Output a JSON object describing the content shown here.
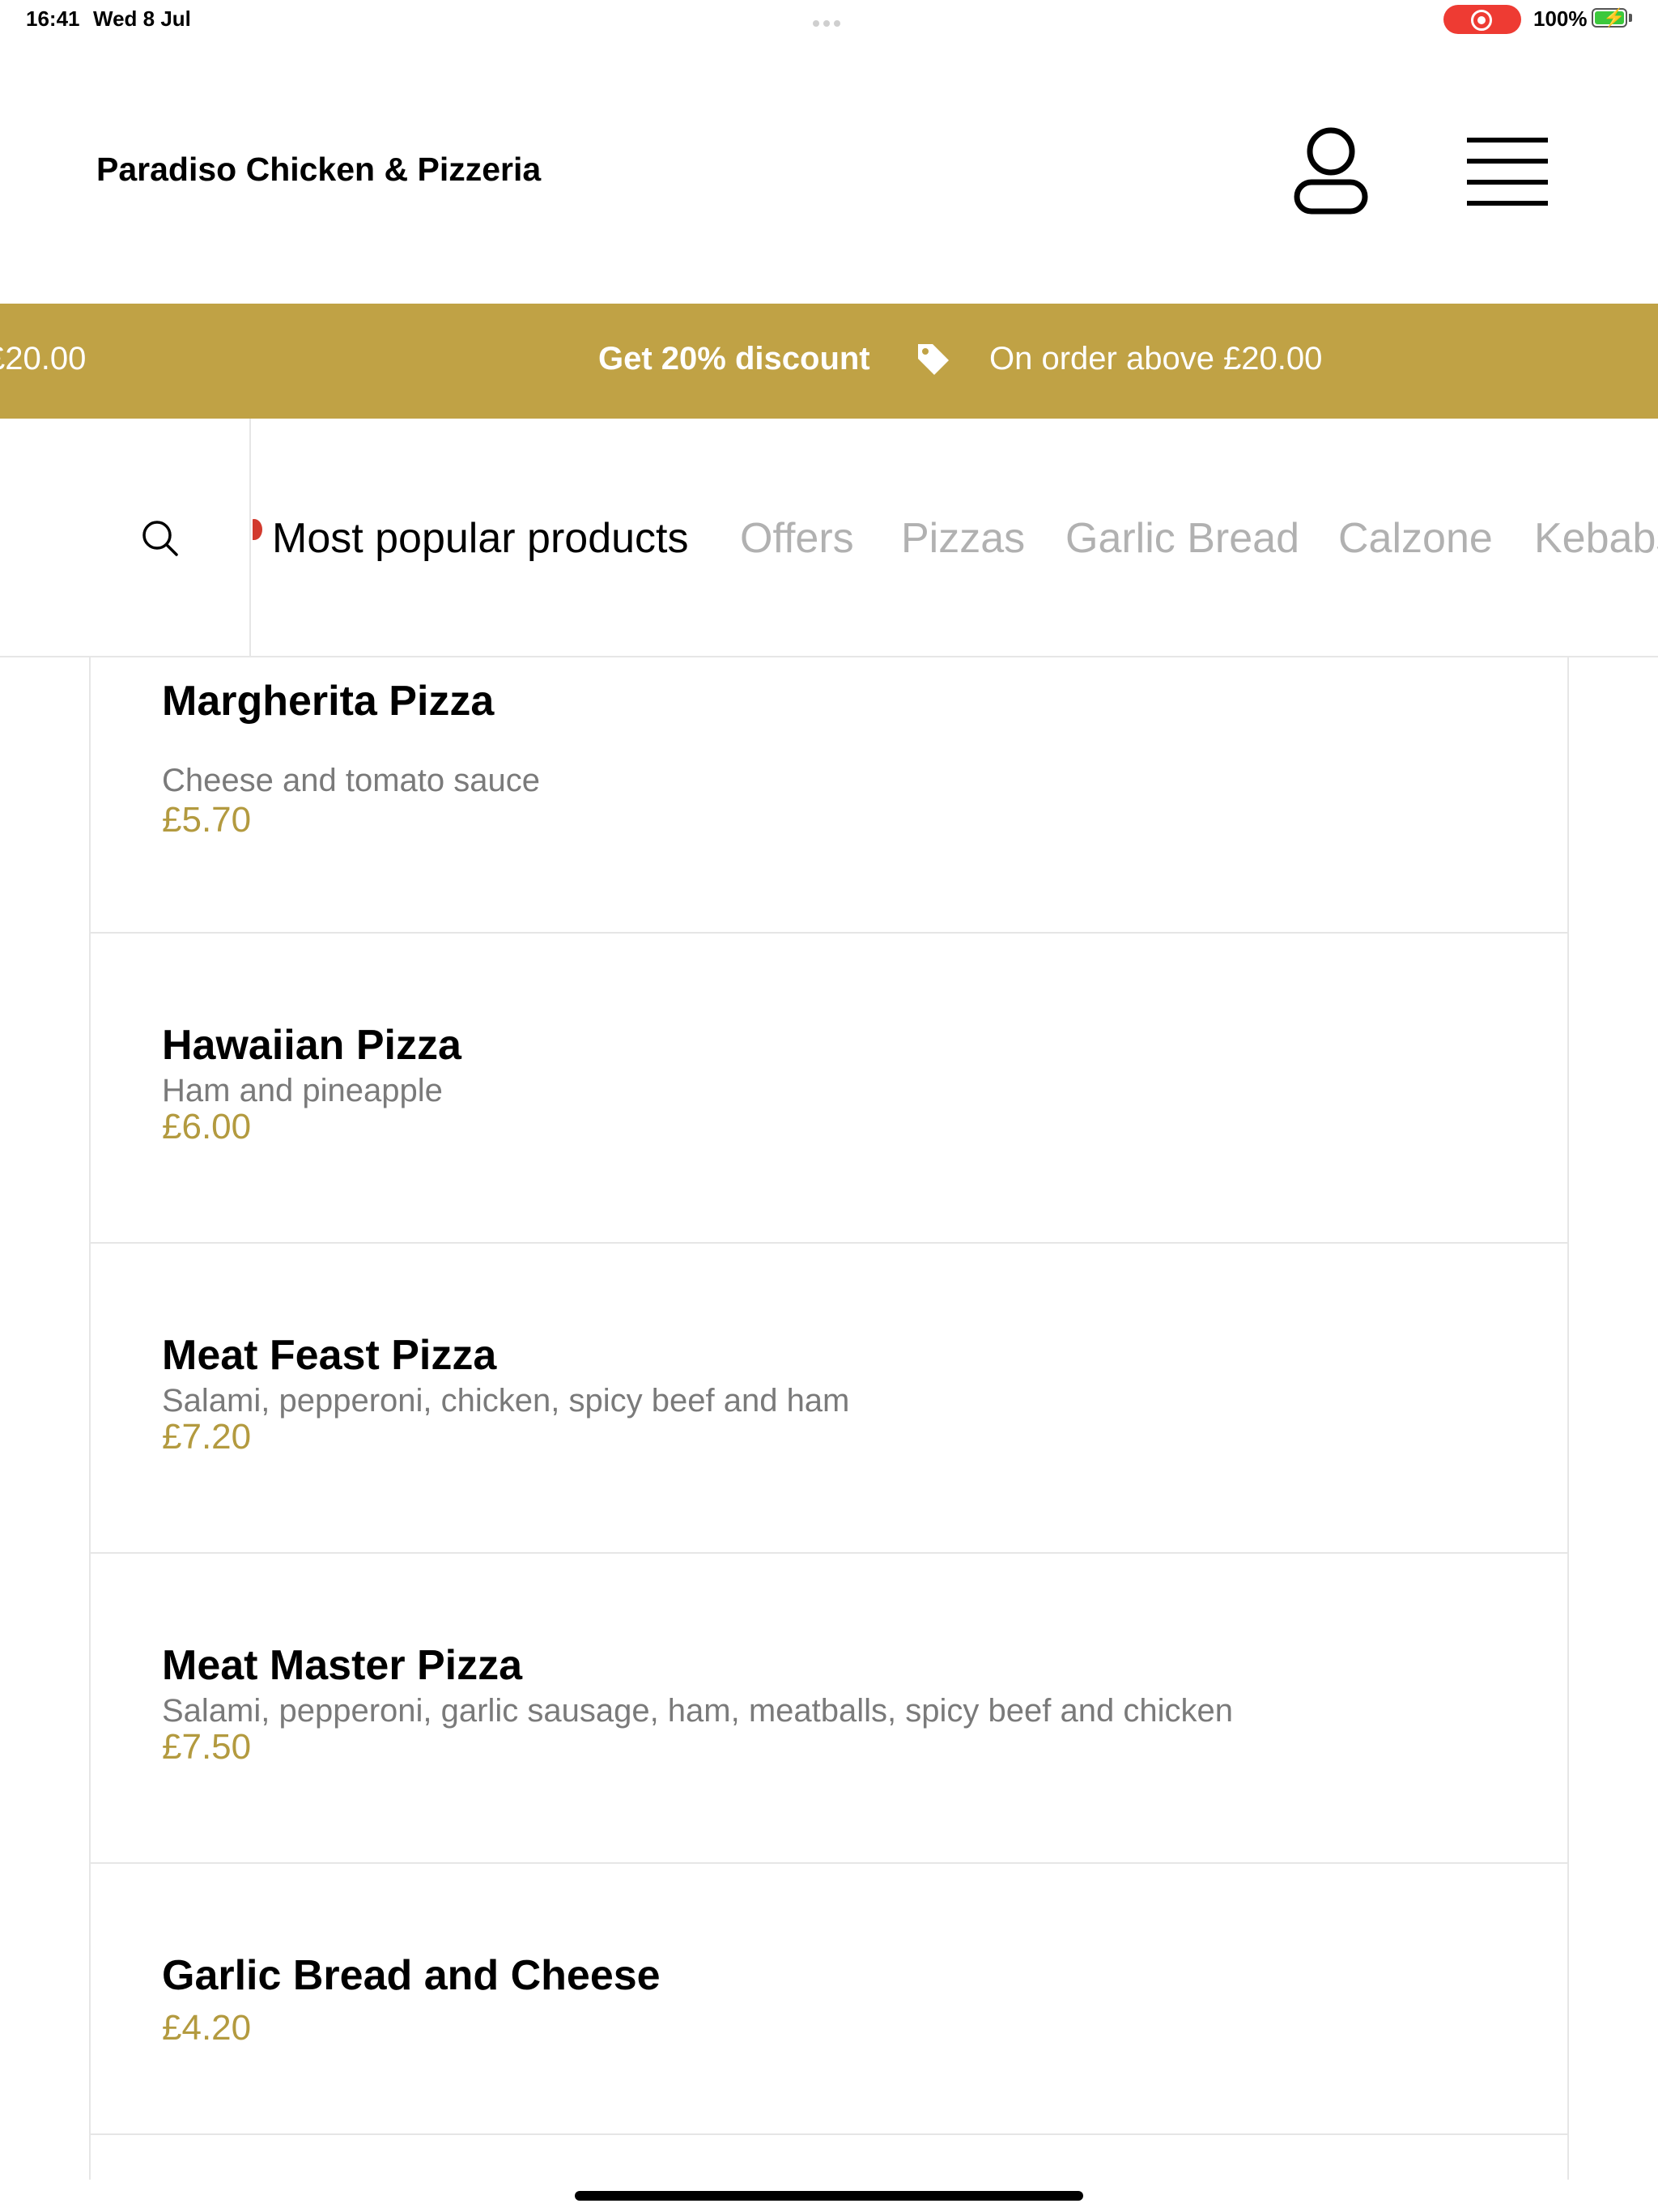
{
  "status_bar": {
    "time": "16:41",
    "date": "Wed 8 Jul",
    "battery_percent": "100%",
    "battery_level": 1.0,
    "recording": true,
    "icons": [
      "screen-recording-icon",
      "battery-charging-icon"
    ]
  },
  "header": {
    "restaurant_name": "Paradiso Chicken & Pizzeria",
    "icons": [
      "user-icon",
      "menu-icon"
    ]
  },
  "promo_banner": {
    "partial_text": "£20.00",
    "title": "Get 20% discount",
    "icon": "tag-icon",
    "text": "On order above £20.00",
    "background_color": "#c0a245"
  },
  "categories": {
    "search_icon": "search-icon",
    "items": [
      "Most popular products",
      "Offers",
      "Pizzas",
      "Garlic Bread",
      "Calzone",
      "Kebabs"
    ],
    "active_index": 0
  },
  "products": [
    {
      "name": "Margherita Pizza",
      "description": "Cheese and tomato sauce",
      "price": "£5.70"
    },
    {
      "name": "Hawaiian Pizza",
      "description": "Ham and pineapple",
      "price": "£6.00"
    },
    {
      "name": "Meat Feast Pizza",
      "description": "Salami, pepperoni, chicken, spicy beef and ham",
      "price": "£7.20"
    },
    {
      "name": "Meat Master Pizza",
      "description": "Salami, pepperoni, garlic sausage, ham, meatballs, spicy beef and chicken",
      "price": "£7.50"
    },
    {
      "name": "Garlic Bread and Cheese",
      "description": "",
      "price": "£4.20"
    }
  ],
  "colors": {
    "accent": "#c0a245",
    "price": "#b39a3f",
    "inactive_category": "#b1b1b1",
    "recording": "#ee3b33"
  }
}
